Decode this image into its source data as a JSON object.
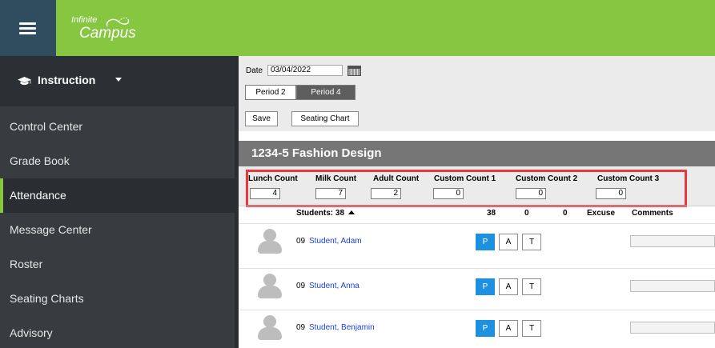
{
  "brand": {
    "line1": "Infinite",
    "line2": "Campus"
  },
  "colors": {
    "topbar": "#86c640",
    "menu_button": "#304c5f",
    "sidebar": "#383b3f",
    "present_button": "#1e90e0",
    "highlight": "#e8383d"
  },
  "sidebar": {
    "header": "Instruction",
    "items": [
      {
        "label": "Control Center"
      },
      {
        "label": "Grade Book"
      },
      {
        "label": "Attendance"
      },
      {
        "label": "Message Center"
      },
      {
        "label": "Roster"
      },
      {
        "label": "Seating Charts"
      },
      {
        "label": "Advisory"
      }
    ]
  },
  "toolbar": {
    "date_label": "Date",
    "date_value": "03/04/2022",
    "periods": [
      "Period 2",
      "Period 4"
    ],
    "selected_period": "Period 4",
    "save_label": "Save",
    "seating_chart_label": "Seating Chart"
  },
  "section": {
    "title": "1234-5 Fashion Design"
  },
  "counts": [
    {
      "label": "Lunch Count",
      "value": "4"
    },
    {
      "label": "Milk Count",
      "value": "7"
    },
    {
      "label": "Adult Count",
      "value": "2"
    },
    {
      "label": "Custom Count 1",
      "value": "0"
    },
    {
      "label": "Custom Count 2",
      "value": "0"
    },
    {
      "label": "Custom Count 3",
      "value": "0"
    }
  ],
  "table_header": {
    "students": "Students: 38",
    "present_total": "38",
    "absent_total": "0",
    "tardy_total": "0",
    "excuse": "Excuse",
    "comments": "Comments"
  },
  "students": [
    {
      "grade": "09",
      "name": "Student, Adam",
      "status": "P"
    },
    {
      "grade": "09",
      "name": "Student, Anna",
      "status": "P"
    },
    {
      "grade": "09",
      "name": "Student, Benjamin",
      "status": "P"
    }
  ],
  "attendance_codes": {
    "present": "P",
    "absent": "A",
    "tardy": "T"
  }
}
